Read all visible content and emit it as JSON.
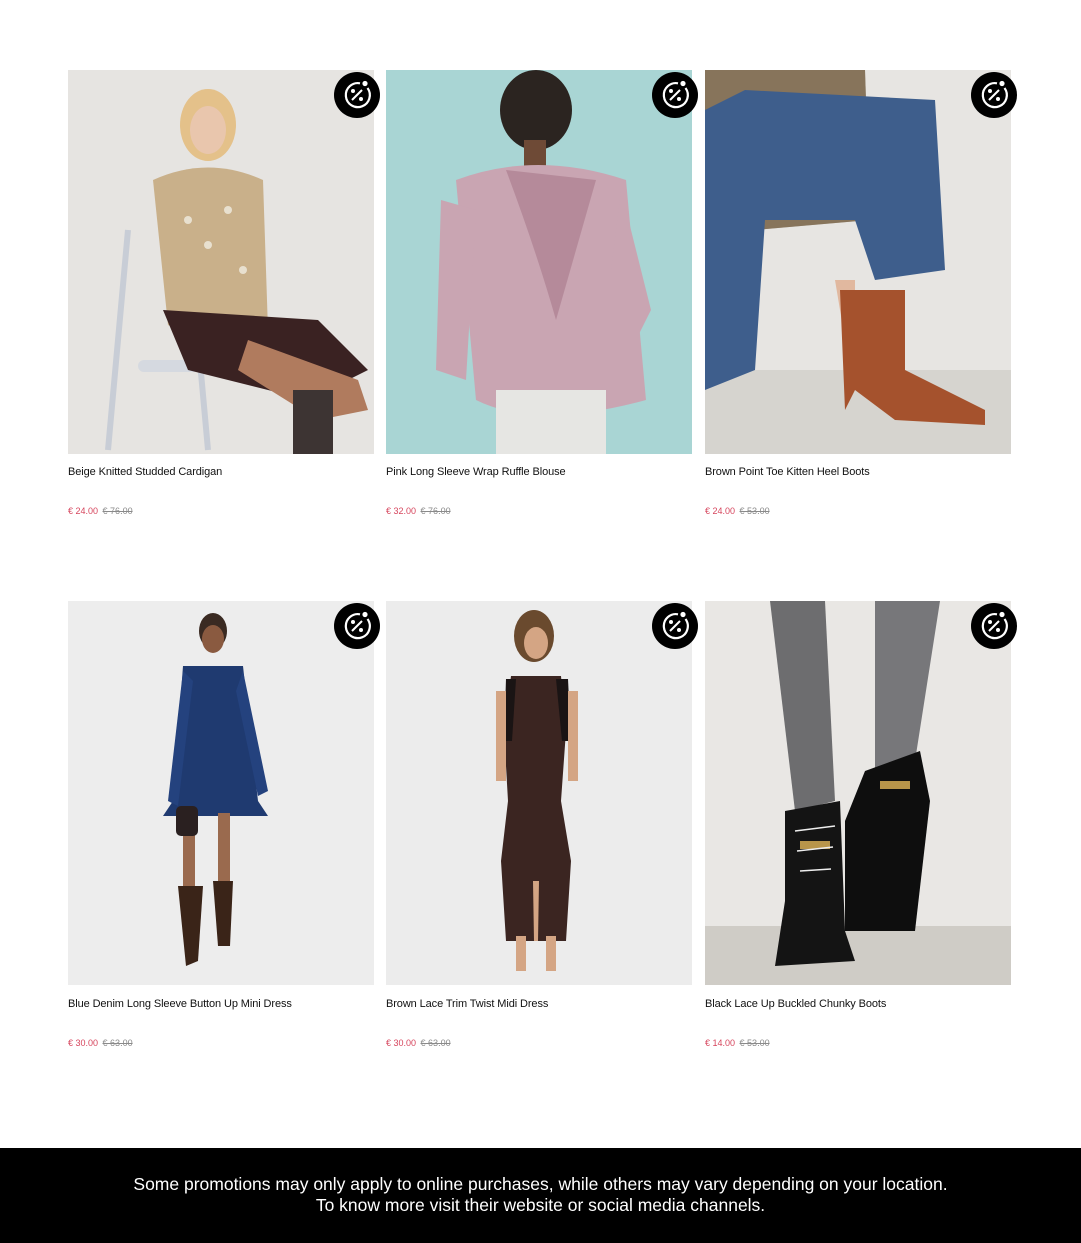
{
  "products": [
    {
      "name": "Beige Knitted Studded Cardigan",
      "price": "€ 24.00",
      "original_price": "€ 76.00",
      "badge_icon": "discount-percent-icon",
      "bg": "#e6e4e1"
    },
    {
      "name": "Pink Long Sleeve Wrap Ruffle Blouse",
      "price": "€ 32.00",
      "original_price": "€ 76.00",
      "badge_icon": "discount-percent-icon",
      "bg": "#9fd0cf"
    },
    {
      "name": "Brown Point Toe Kitten Heel Boots",
      "price": "€ 24.00",
      "original_price": "€ 53.00",
      "badge_icon": "discount-percent-icon",
      "bg": "#e7e5e2"
    },
    {
      "name": "Blue Denim Long Sleeve Button Up Mini Dress",
      "price": "€ 30.00",
      "original_price": "€ 63.00",
      "badge_icon": "discount-percent-icon",
      "bg": "#ededed"
    },
    {
      "name": "Brown Lace Trim Twist Midi Dress",
      "price": "€ 30.00",
      "original_price": "€ 63.00",
      "badge_icon": "discount-percent-icon",
      "bg": "#ececec"
    },
    {
      "name": "Black Lace Up Buckled Chunky Boots",
      "price": "€ 14.00",
      "original_price": "€ 53.00",
      "badge_icon": "discount-percent-icon",
      "bg": "#e9e7e4"
    }
  ],
  "footer": {
    "line1": "Some promotions may only apply to online purchases, while others may vary depending on your location.",
    "line2": "To know more visit their website or social media channels."
  },
  "colors": {
    "sale_price": "#d6455d",
    "original_price": "#8a8a8a",
    "footer_bg": "#000000"
  }
}
